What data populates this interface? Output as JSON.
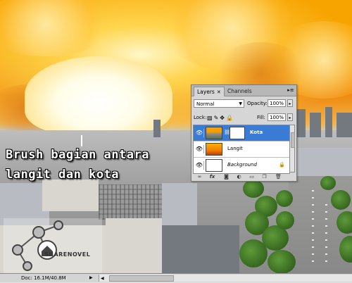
{
  "caption": {
    "line1": "Brush bagian antara",
    "line2": "langit dan kota"
  },
  "watermark": {
    "text": "SHARENOVEL"
  },
  "layers_panel": {
    "tabs": [
      {
        "label": "Layers",
        "active": true
      },
      {
        "label": "Channels",
        "active": false
      }
    ],
    "tab_close_icon": "close-icon",
    "panel_menu_icon": "panel-menu-icon",
    "blend_mode": "Normal",
    "opacity_label": "Opacity:",
    "opacity_value": "100%",
    "lock_label": "Lock:",
    "lock_icons": [
      "lock-transparency-icon",
      "lock-pixels-icon",
      "lock-position-icon",
      "lock-all-icon"
    ],
    "fill_label": "Fill:",
    "fill_value": "100%",
    "layers": [
      {
        "name": "Kota",
        "selected": true,
        "has_mask": true
      },
      {
        "name": "Langit",
        "selected": false,
        "has_mask": false
      },
      {
        "name": "Background",
        "selected": false,
        "locked": true
      }
    ],
    "bottom_icons": [
      "link-layers-icon",
      "fx-icon",
      "add-mask-icon",
      "adjustment-layer-icon",
      "new-group-icon",
      "new-layer-icon",
      "delete-layer-icon"
    ]
  },
  "status_bar": {
    "doc_info": "Doc: 16.1M/40.8M"
  },
  "colors": {
    "selection_blue": "#3a7bd5",
    "panel_gray": "#d6d6d6"
  }
}
